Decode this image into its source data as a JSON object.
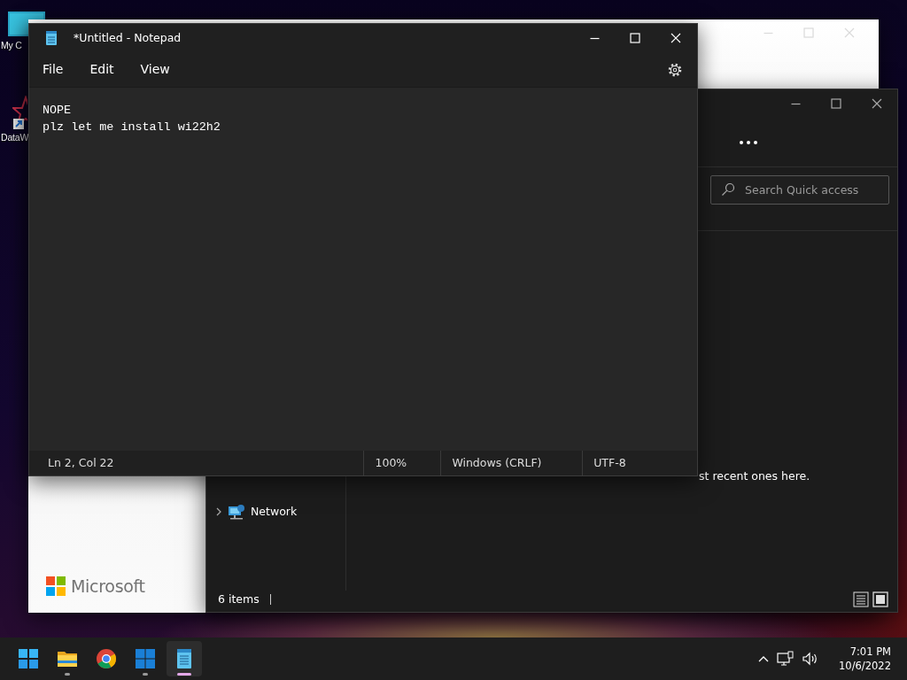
{
  "desktop_icons": [
    {
      "kind": "computer",
      "label": "My C"
    },
    {
      "kind": "shortcut",
      "label": "DataW"
    }
  ],
  "setup_window": {
    "logo_text": "Microsoft"
  },
  "explorer": {
    "search": {
      "placeholder": "Search Quick access"
    },
    "nav": [
      {
        "label": "Network",
        "expanded": false
      }
    ],
    "content_text": "st recent ones here.",
    "status": "6 items"
  },
  "notepad": {
    "title": "*Untitled - Notepad",
    "menus": [
      "File",
      "Edit",
      "View"
    ],
    "lines": [
      "NOPE",
      "plz let me install wi22h2"
    ],
    "status": [
      "Ln 2, Col 22",
      "100%",
      "Windows (CRLF)",
      "UTF-8"
    ]
  },
  "taskbar": {
    "apps": [
      {
        "kind": "start",
        "running": false,
        "active": false
      },
      {
        "kind": "folder",
        "running": true,
        "active": false
      },
      {
        "kind": "chrome",
        "running": false,
        "active": false
      },
      {
        "kind": "windows",
        "running": true,
        "active": false
      },
      {
        "kind": "notepad",
        "running": true,
        "active": true
      }
    ],
    "time": "7:01 PM",
    "date": "10/6/2022"
  }
}
